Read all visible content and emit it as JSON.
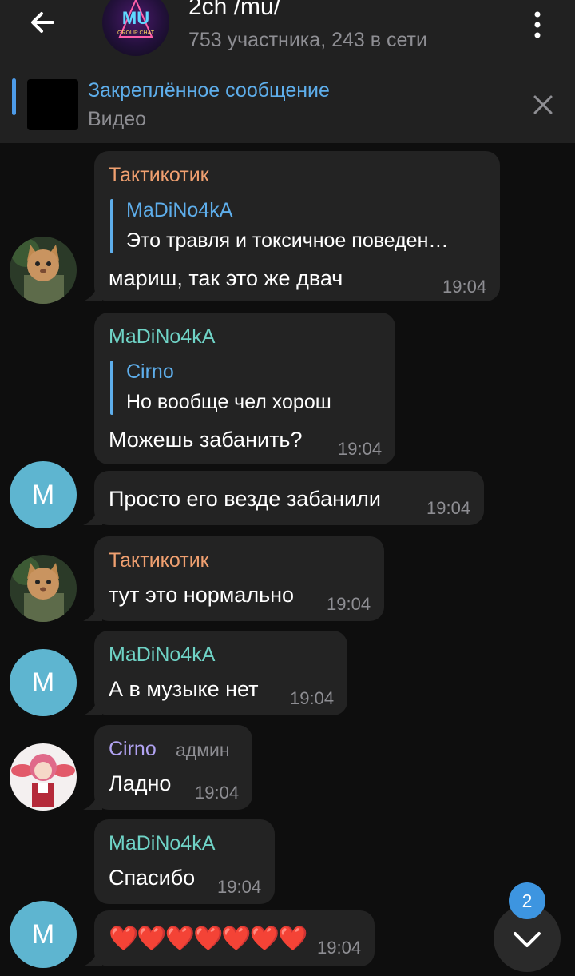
{
  "header": {
    "title": "2ch /mu/",
    "subtitle": "753 участника, 243 в сети",
    "avatar_logo_text": "MU",
    "avatar_logo_sub": "GROUP CHAT"
  },
  "pinned": {
    "title": "Закреплённое сообщение",
    "subtitle": "Видео"
  },
  "colors": {
    "background": "#0e0e0e",
    "bubble": "#232323",
    "header": "#212121",
    "accent": "#5eaeeb",
    "name_orange": "#f0a070",
    "name_teal": "#6fd3c6",
    "name_violet": "#b1a3f2",
    "time": "#8e8e93"
  },
  "messages": [
    {
      "sender": "Тактикотик",
      "reply_name": "MaDiNo4kA",
      "reply_text": "Это травля и токсичное поведен…",
      "text": "мариш, так это же двач",
      "time": "19:04",
      "avatar": "cat-avatar"
    },
    {
      "sender": "MaDiNo4kA",
      "reply_name": "Cirno",
      "reply_text": "Но вообще чел хорош",
      "text": "Можешь забанить?",
      "time": "19:04"
    },
    {
      "text": "Просто его везде забанили",
      "time": "19:04",
      "avatar_letter": "M"
    },
    {
      "sender": "Тактикотик",
      "text": "тут это нормально",
      "time": "19:04",
      "avatar": "cat-avatar"
    },
    {
      "sender": "MaDiNo4kA",
      "text": "А в музыке нет",
      "time": "19:04",
      "avatar_letter": "M"
    },
    {
      "sender": "Cirno",
      "role": "админ",
      "text": "Ладно",
      "time": "19:04",
      "avatar": "anime-avatar"
    },
    {
      "sender": "MaDiNo4kA",
      "text": "Спасибо",
      "time": "19:04"
    },
    {
      "text": "❤️❤️❤️❤️❤️❤️❤️",
      "time": "19:04",
      "avatar_letter": "M"
    }
  ],
  "scroll_down": {
    "unread_count": "2"
  }
}
